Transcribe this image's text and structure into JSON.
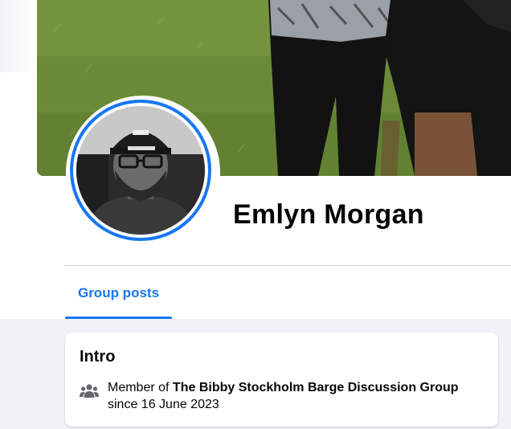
{
  "profile": {
    "name": "Emlyn Morgan"
  },
  "tabs": [
    {
      "label": "Group posts",
      "active": true
    }
  ],
  "intro": {
    "title": "Intro",
    "member_prefix": "Member of ",
    "group_name": "The Bibby Stockholm Barge Discussion Group",
    "since": "since 16 June 2023"
  },
  "colors": {
    "accent": "#1877f2",
    "page_bg": "#f0f2f5",
    "text": "#050505"
  }
}
